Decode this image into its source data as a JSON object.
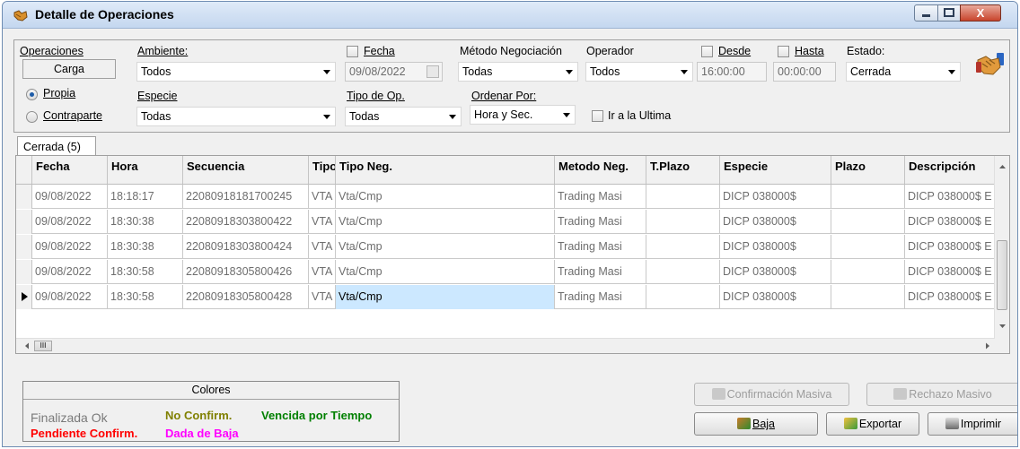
{
  "window": {
    "title": "Detalle de Operaciones",
    "close_glyph": "X"
  },
  "filters": {
    "operaciones_label": "Operaciones",
    "carga_label": "Carga",
    "radio_propia": "Propia",
    "radio_contraparte": "Contraparte",
    "ambiente_label": "Ambiente:",
    "ambiente_value": "Todos",
    "fecha_label": "Fecha",
    "fecha_value": "09/08/2022",
    "metodo_label": "Método Negociación",
    "metodo_value": "Todas",
    "operador_label": "Operador",
    "operador_value": "Todos",
    "desde_label": "Desde",
    "desde_value": "16:00:00",
    "hasta_label": "Hasta",
    "hasta_value": "00:00:00",
    "estado_label": "Estado:",
    "estado_value": "Cerrada",
    "especie_label": "Especie",
    "especie_value": "Todas",
    "tipo_op_label": "Tipo de Op.",
    "tipo_op_value": "Todas",
    "ordenar_label": "Ordenar Por:",
    "ordenar_value": "Hora y Sec.",
    "ir_ultima_label": "Ir a la Ultima"
  },
  "tab": {
    "label": "Cerrada (5)"
  },
  "grid": {
    "headers": [
      "Fecha",
      "Hora",
      "Secuencia",
      "Tipo",
      "Tipo Neg.",
      "Metodo Neg.",
      "T.Plazo",
      "Especie",
      "Plazo",
      "Descripción"
    ],
    "rows": [
      [
        "09/08/2022",
        "18:18:17",
        "22080918181700245",
        "VTA",
        "Vta/Cmp",
        "Trading Masi",
        "",
        "DICP  038000$",
        "",
        "DICP  038000$ E"
      ],
      [
        "09/08/2022",
        "18:30:38",
        "22080918303800422",
        "VTA",
        "Vta/Cmp",
        "Trading Masi",
        "",
        "DICP  038000$",
        "",
        "DICP  038000$ E"
      ],
      [
        "09/08/2022",
        "18:30:38",
        "22080918303800424",
        "VTA",
        "Vta/Cmp",
        "Trading Masi",
        "",
        "DICP  038000$",
        "",
        "DICP  038000$ E"
      ],
      [
        "09/08/2022",
        "18:30:58",
        "22080918305800426",
        "VTA",
        "Vta/Cmp",
        "Trading Masi",
        "",
        "DICP  038000$",
        "",
        "DICP  038000$ E"
      ],
      [
        "09/08/2022",
        "18:30:58",
        "22080918305800428",
        "VTA",
        "Vta/Cmp",
        "Trading Masi",
        "",
        "DICP  038000$",
        "",
        "DICP  038000$ E"
      ]
    ],
    "hscroll_thumb": "III"
  },
  "colores": {
    "title": "Colores",
    "finalizada": "Finalizada Ok",
    "no_confirm": "No Confirm.",
    "vencida": "Vencida por Tiempo",
    "pendiente": "Pendiente Confirm.",
    "dada_baja": "Dada de Baja"
  },
  "buttons": {
    "confirmacion_masiva": "Confirmación Masiva",
    "rechazo_masivo": "Rechazo Masivo",
    "baja": "Baja",
    "exportar": "Exportar",
    "imprimir": "Imprimir"
  },
  "colors": {
    "finalizada": "#7a7a7a",
    "no_confirm": "#808000",
    "vencida": "#008000",
    "pendiente": "#ff0000",
    "dada_baja": "#ff00ff",
    "selected_cell": "#cce8ff"
  }
}
